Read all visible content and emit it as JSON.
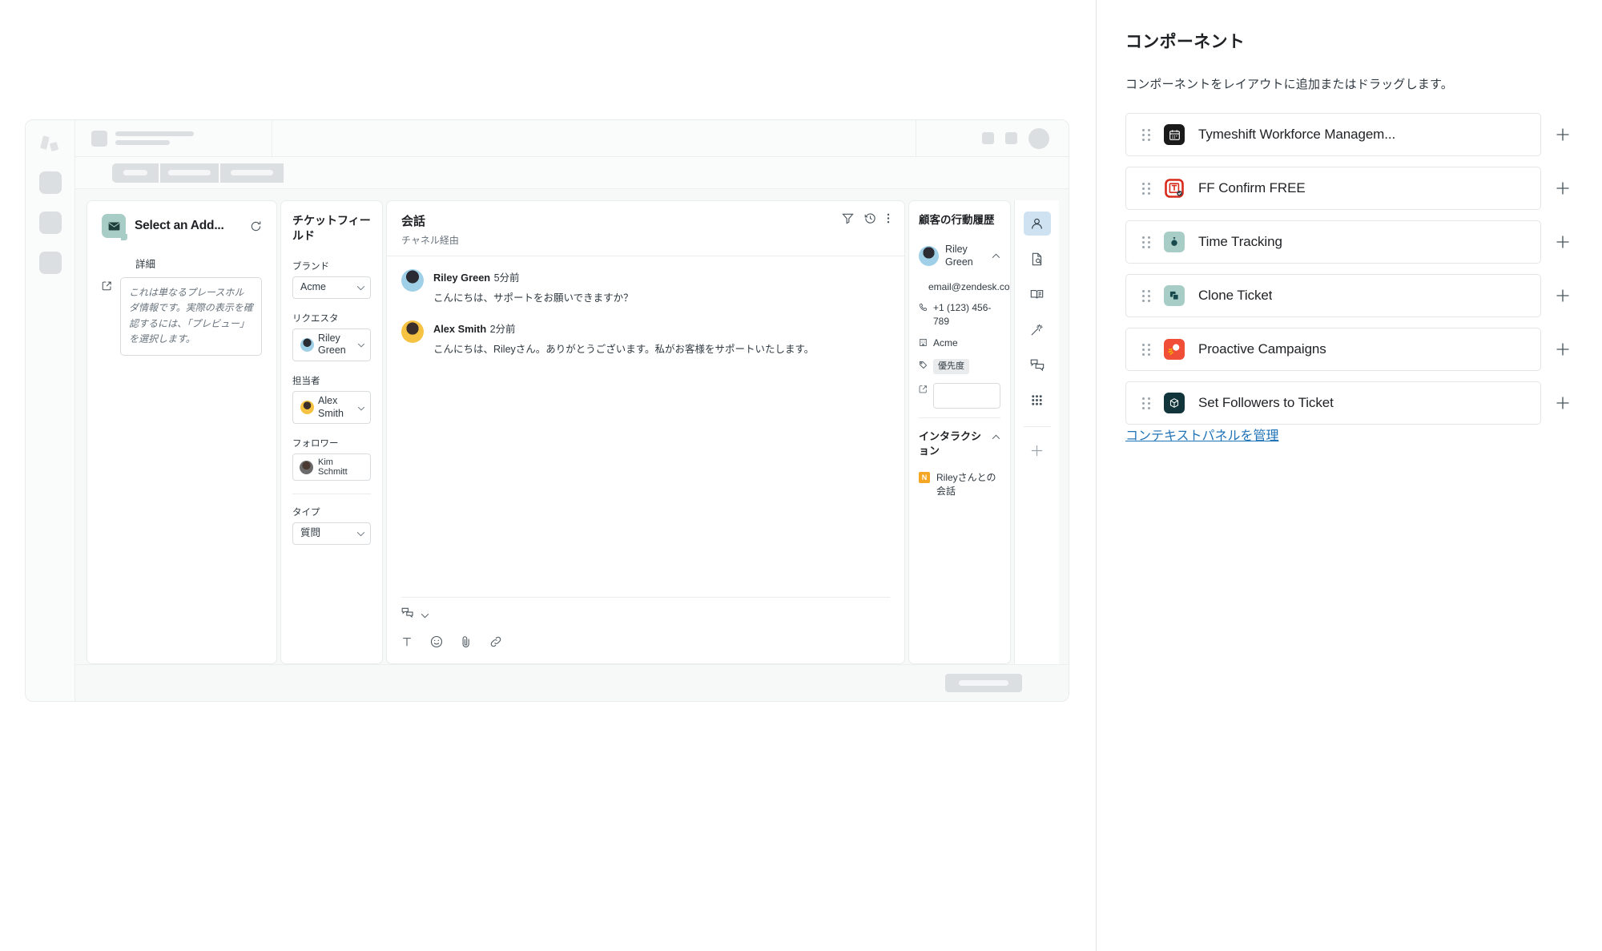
{
  "side_panel": {
    "title": "コンポーネント",
    "description": "コンポーネントをレイアウトに追加またはドラッグします。",
    "manage_link": "コンテキストパネルを管理",
    "components": [
      {
        "label": "Tymeshift Workforce Managem...",
        "icon": "calendar-app-icon",
        "icon_bg": "#1a1a1a",
        "icon_fg": "#ffffff",
        "glyph": "▦",
        "add_label": "+"
      },
      {
        "label": "FF Confirm FREE",
        "icon": "ff-confirm-app-icon",
        "icon_bg": "#ffffff",
        "icon_fg": "#d92b1c",
        "glyph": "▣",
        "add_label": "+"
      },
      {
        "label": "Time Tracking",
        "icon": "stopwatch-app-icon",
        "icon_bg": "#a8cdc6",
        "icon_fg": "#17494d",
        "glyph": "⏱",
        "add_label": "+"
      },
      {
        "label": "Clone Ticket",
        "icon": "copy-app-icon",
        "icon_bg": "#a8cdc6",
        "icon_fg": "#17494d",
        "glyph": "❐",
        "add_label": "+"
      },
      {
        "label": "Proactive Campaigns",
        "icon": "campaign-app-icon",
        "icon_bg": "#f04e36",
        "icon_fg": "#ffffff",
        "glyph": "◯",
        "add_label": "+"
      },
      {
        "label": "Set Followers to Ticket",
        "icon": "cube-app-icon",
        "icon_bg": "#12343b",
        "icon_fg": "#ffffff",
        "glyph": "⬡",
        "add_label": "+"
      }
    ]
  },
  "preview": {
    "apps_panel": {
      "title": "Select an Add...",
      "icon": "envelope-app-icon",
      "refresh_icon": "refresh-icon",
      "detail_label": "詳細",
      "placeholder_text": "これは単なるプレースホルダ情報です。実際の表示を確認するには、「プレビュー」を選択します。"
    },
    "ticket_fields": {
      "title": "チケットフィールド",
      "fields": [
        {
          "label": "ブランド",
          "value": "Acme",
          "type": "select"
        },
        {
          "label": "リクエスタ",
          "value": "Riley Green",
          "type": "user-select"
        },
        {
          "label": "担当者",
          "value": "Alex Smith",
          "type": "user-select"
        },
        {
          "label": "フォロワー",
          "value": "Kim Schmitt",
          "type": "tag"
        },
        {
          "label": "タイプ",
          "value": "質問",
          "type": "select"
        }
      ]
    },
    "conversation": {
      "title": "会話",
      "subtitle": "チャネル経由",
      "actions": [
        "filter-icon",
        "history-icon",
        "more-options-icon"
      ],
      "messages": [
        {
          "author": "Riley Green",
          "time": "5分前",
          "text": "こんにちは、サポートをお願いできますか？"
        },
        {
          "author": "Alex Smith",
          "time": "2分前",
          "text": "こんにちは、Rileyさん。ありがとうございます。私がお客様をサポートいたします。"
        }
      ],
      "footer_icons": [
        "reply-icon",
        "chevron-down-icon"
      ],
      "composer_icons": [
        "text-format-icon",
        "emoji-icon",
        "attachment-icon",
        "link-icon"
      ]
    },
    "customer": {
      "title": "顧客の行動履歴",
      "name": "Riley Green",
      "email": "email@zendesk.co",
      "phone": "+1 (123) 456-789",
      "org": "Acme",
      "tag": "優先度",
      "note_value": "",
      "interactions_title": "インタラクション",
      "interactions": [
        {
          "badge": "N",
          "text": "Rileyさんとの会話"
        }
      ]
    },
    "context_rail": [
      "user-icon",
      "document-search-icon",
      "knowledge-book-icon",
      "magic-wand-icon",
      "chat-bubbles-icon",
      "apps-grid-icon",
      "add-icon"
    ]
  }
}
